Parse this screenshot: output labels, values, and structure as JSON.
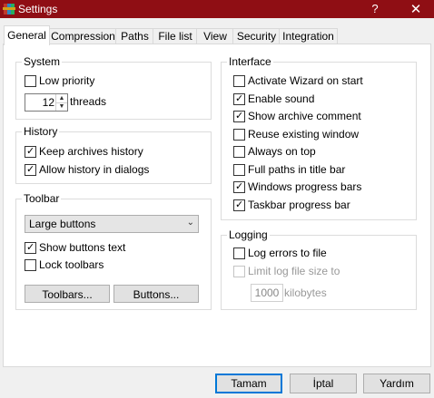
{
  "window": {
    "title": "Settings",
    "help": "?",
    "close": "✕"
  },
  "tabs": [
    "General",
    "Compression",
    "Paths",
    "File list",
    "View",
    "Security",
    "Integration"
  ],
  "system": {
    "legend": "System",
    "low_priority": "Low priority",
    "threads_value": "12",
    "threads_label": "threads"
  },
  "history": {
    "legend": "History",
    "keep": "Keep archives history",
    "allow": "Allow history in dialogs"
  },
  "toolbar": {
    "legend": "Toolbar",
    "select_value": "Large buttons",
    "show_text": "Show buttons text",
    "lock": "Lock toolbars",
    "toolbars_btn": "Toolbars...",
    "buttons_btn": "Buttons..."
  },
  "interface": {
    "legend": "Interface",
    "items": [
      {
        "label": "Activate Wizard on start",
        "checked": false
      },
      {
        "label": "Enable sound",
        "checked": true
      },
      {
        "label": "Show archive comment",
        "checked": true
      },
      {
        "label": "Reuse existing window",
        "checked": false
      },
      {
        "label": "Always on top",
        "checked": false
      },
      {
        "label": "Full paths in title bar",
        "checked": false
      },
      {
        "label": "Windows progress bars",
        "checked": true
      },
      {
        "label": "Taskbar progress bar",
        "checked": true
      }
    ]
  },
  "logging": {
    "legend": "Logging",
    "log_errors": "Log errors to file",
    "limit": "Limit log file size to",
    "size_value": "1000",
    "size_unit": "kilobytes"
  },
  "footer": {
    "ok": "Tamam",
    "cancel": "İptal",
    "help": "Yardım"
  },
  "colors": {
    "titlebar": "#8f0e14",
    "accent": "#0078d7"
  }
}
